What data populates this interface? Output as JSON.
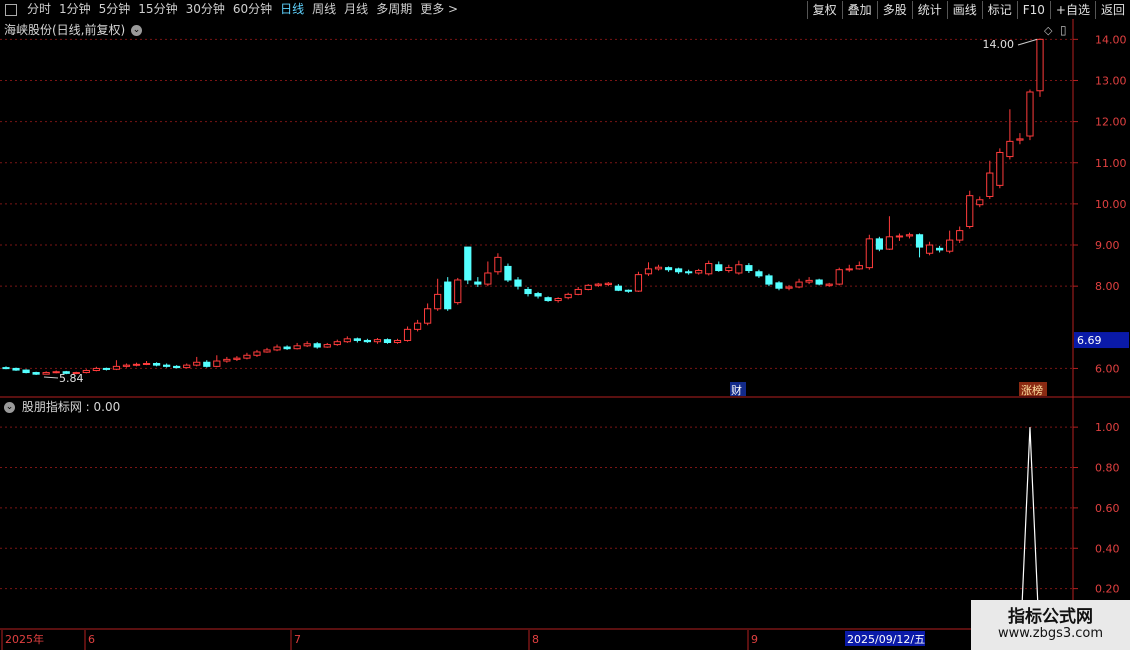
{
  "toolbar": {
    "periods": [
      "分时",
      "1分钟",
      "5分钟",
      "15分钟",
      "30分钟",
      "60分钟",
      "日线",
      "周线",
      "月线",
      "多周期",
      "更多 >"
    ],
    "active_period": "日线",
    "actions": [
      "复权",
      "叠加",
      "多股",
      "统计",
      "画线",
      "F10",
      "+自选",
      "返回"
    ],
    "mark_label": "标记"
  },
  "main_pane": {
    "title": "海峡股份(日线,前复权)",
    "price_axis": [
      "14.00",
      "13.00",
      "12.00",
      "11.00",
      "10.00",
      "9.00",
      "8.00",
      "6.00"
    ],
    "current_price": "6.69",
    "high_label": "14.00",
    "low_label": "5.84",
    "events": [
      "财",
      "涨榜"
    ]
  },
  "indicator_pane": {
    "title": "股朋指标网 : 0.00",
    "axis": [
      "1.00",
      "0.80",
      "0.60",
      "0.40",
      "0.20"
    ]
  },
  "time_axis": {
    "labels": [
      "2025年",
      "6",
      "7",
      "8",
      "9"
    ],
    "cursor_date": "2025/09/12/五"
  },
  "watermark": {
    "title": "指标公式网",
    "url": "www.zbgs3.com"
  },
  "colors": {
    "up": "#ff3c3c",
    "down": "#54ffff",
    "grid": "#7a1515",
    "frame": "#b52020",
    "active_period": "#5fd3ff"
  },
  "chart_data": {
    "type": "candlestick",
    "title": "海峡股份(日线,前复权)",
    "y_ticks": [
      6,
      8,
      9,
      10,
      11,
      12,
      13,
      14
    ],
    "ylim": [
      5.5,
      14.3
    ],
    "candles": [
      [
        6.02,
        6.0,
        6.05,
        5.98
      ],
      [
        6.0,
        5.96,
        6.02,
        5.94
      ],
      [
        5.96,
        5.9,
        5.98,
        5.88
      ],
      [
        5.9,
        5.86,
        5.92,
        5.84
      ],
      [
        5.86,
        5.9,
        5.93,
        5.85
      ],
      [
        5.9,
        5.92,
        5.95,
        5.88
      ],
      [
        5.92,
        5.88,
        5.94,
        5.86
      ],
      [
        5.88,
        5.9,
        5.92,
        5.86
      ],
      [
        5.9,
        5.95,
        5.98,
        5.88
      ],
      [
        5.95,
        6.0,
        6.04,
        5.93
      ],
      [
        6.0,
        5.98,
        6.02,
        5.95
      ],
      [
        5.98,
        6.05,
        6.2,
        5.96
      ],
      [
        6.05,
        6.08,
        6.12,
        6.02
      ],
      [
        6.08,
        6.1,
        6.14,
        6.05
      ],
      [
        6.1,
        6.12,
        6.18,
        6.08
      ],
      [
        6.12,
        6.08,
        6.15,
        6.05
      ],
      [
        6.08,
        6.05,
        6.12,
        6.02
      ],
      [
        6.05,
        6.02,
        6.08,
        6.0
      ],
      [
        6.02,
        6.08,
        6.12,
        6.0
      ],
      [
        6.08,
        6.15,
        6.28,
        6.05
      ],
      [
        6.15,
        6.05,
        6.2,
        6.02
      ],
      [
        6.05,
        6.18,
        6.32,
        6.03
      ],
      [
        6.18,
        6.22,
        6.28,
        6.14
      ],
      [
        6.22,
        6.25,
        6.3,
        6.18
      ],
      [
        6.25,
        6.32,
        6.38,
        6.22
      ],
      [
        6.32,
        6.4,
        6.45,
        6.28
      ],
      [
        6.4,
        6.45,
        6.5,
        6.38
      ],
      [
        6.45,
        6.52,
        6.58,
        6.42
      ],
      [
        6.52,
        6.48,
        6.56,
        6.45
      ],
      [
        6.48,
        6.55,
        6.62,
        6.46
      ],
      [
        6.55,
        6.6,
        6.66,
        6.52
      ],
      [
        6.6,
        6.52,
        6.64,
        6.48
      ],
      [
        6.52,
        6.58,
        6.62,
        6.5
      ],
      [
        6.58,
        6.65,
        6.7,
        6.55
      ],
      [
        6.65,
        6.72,
        6.78,
        6.62
      ],
      [
        6.72,
        6.68,
        6.75,
        6.63
      ],
      [
        6.68,
        6.65,
        6.72,
        6.62
      ],
      [
        6.65,
        6.7,
        6.74,
        6.6
      ],
      [
        6.7,
        6.63,
        6.73,
        6.6
      ],
      [
        6.63,
        6.68,
        6.72,
        6.6
      ],
      [
        6.68,
        6.95,
        7.02,
        6.65
      ],
      [
        6.95,
        7.1,
        7.18,
        6.9
      ],
      [
        7.1,
        7.45,
        7.58,
        7.05
      ],
      [
        7.45,
        7.8,
        8.18,
        7.4
      ],
      [
        8.1,
        7.45,
        8.22,
        7.4
      ],
      [
        7.6,
        8.15,
        8.2,
        7.55
      ],
      [
        8.95,
        8.15,
        8.95,
        8.05
      ],
      [
        8.1,
        8.05,
        8.22,
        7.98
      ],
      [
        8.05,
        8.32,
        8.6,
        8.0
      ],
      [
        8.35,
        8.7,
        8.8,
        8.28
      ],
      [
        8.48,
        8.15,
        8.55,
        8.1
      ],
      [
        8.15,
        8.0,
        8.22,
        7.92
      ],
      [
        7.92,
        7.82,
        7.98,
        7.75
      ],
      [
        7.82,
        7.76,
        7.86,
        7.7
      ],
      [
        7.72,
        7.65,
        7.75,
        7.62
      ],
      [
        7.65,
        7.7,
        7.73,
        7.6
      ],
      [
        7.72,
        7.8,
        7.84,
        7.68
      ],
      [
        7.8,
        7.92,
        7.98,
        7.78
      ],
      [
        7.92,
        8.02,
        8.05,
        7.9
      ],
      [
        8.02,
        8.05,
        8.08,
        7.98
      ],
      [
        8.04,
        8.07,
        8.1,
        8.0
      ],
      [
        8.0,
        7.9,
        8.05,
        7.88
      ],
      [
        7.9,
        7.88,
        7.92,
        7.84
      ],
      [
        7.88,
        8.28,
        8.35,
        7.86
      ],
      [
        8.3,
        8.42,
        8.58,
        8.25
      ],
      [
        8.42,
        8.46,
        8.52,
        8.38
      ],
      [
        8.45,
        8.4,
        8.48,
        8.35
      ],
      [
        8.42,
        8.35,
        8.45,
        8.3
      ],
      [
        8.35,
        8.33,
        8.4,
        8.28
      ],
      [
        8.32,
        8.38,
        8.42,
        8.28
      ],
      [
        8.3,
        8.55,
        8.62,
        8.26
      ],
      [
        8.52,
        8.38,
        8.6,
        8.35
      ],
      [
        8.38,
        8.45,
        8.52,
        8.33
      ],
      [
        8.32,
        8.52,
        8.62,
        8.28
      ],
      [
        8.5,
        8.38,
        8.56,
        8.32
      ],
      [
        8.35,
        8.25,
        8.4,
        8.2
      ],
      [
        8.25,
        8.05,
        8.3,
        8.0
      ],
      [
        8.08,
        7.95,
        8.12,
        7.9
      ],
      [
        7.95,
        7.98,
        8.03,
        7.9
      ],
      [
        7.98,
        8.1,
        8.18,
        7.95
      ],
      [
        8.1,
        8.14,
        8.22,
        8.05
      ],
      [
        8.15,
        8.05,
        8.18,
        8.02
      ],
      [
        8.02,
        8.05,
        8.08,
        7.98
      ],
      [
        8.05,
        8.4,
        8.45,
        8.02
      ],
      [
        8.4,
        8.42,
        8.52,
        8.35
      ],
      [
        8.42,
        8.5,
        8.6,
        8.4
      ],
      [
        8.45,
        9.15,
        9.25,
        8.4
      ],
      [
        9.15,
        8.9,
        9.2,
        8.85
      ],
      [
        8.9,
        9.2,
        9.7,
        8.88
      ],
      [
        9.2,
        9.22,
        9.28,
        9.1
      ],
      [
        9.22,
        9.25,
        9.3,
        9.16
      ],
      [
        9.25,
        8.95,
        9.28,
        8.7
      ],
      [
        8.8,
        9.0,
        9.08,
        8.75
      ],
      [
        8.92,
        8.88,
        8.98,
        8.82
      ],
      [
        8.85,
        9.12,
        9.35,
        8.8
      ],
      [
        9.12,
        9.35,
        9.45,
        9.05
      ],
      [
        9.45,
        10.2,
        10.32,
        9.4
      ],
      [
        9.98,
        10.1,
        10.18,
        9.92
      ],
      [
        10.18,
        10.75,
        11.05,
        10.12
      ],
      [
        10.45,
        11.25,
        11.35,
        10.38
      ],
      [
        11.15,
        11.52,
        12.3,
        11.08
      ],
      [
        11.55,
        11.58,
        11.72,
        11.45
      ],
      [
        11.65,
        12.72,
        12.78,
        11.55
      ],
      [
        12.75,
        14.0,
        14.02,
        12.6
      ]
    ],
    "indicator": {
      "name": "股朋指标网",
      "last_value": 0.0,
      "ylim": [
        0,
        1.08
      ],
      "peak_index": 102,
      "peak_value": 1.0
    }
  }
}
